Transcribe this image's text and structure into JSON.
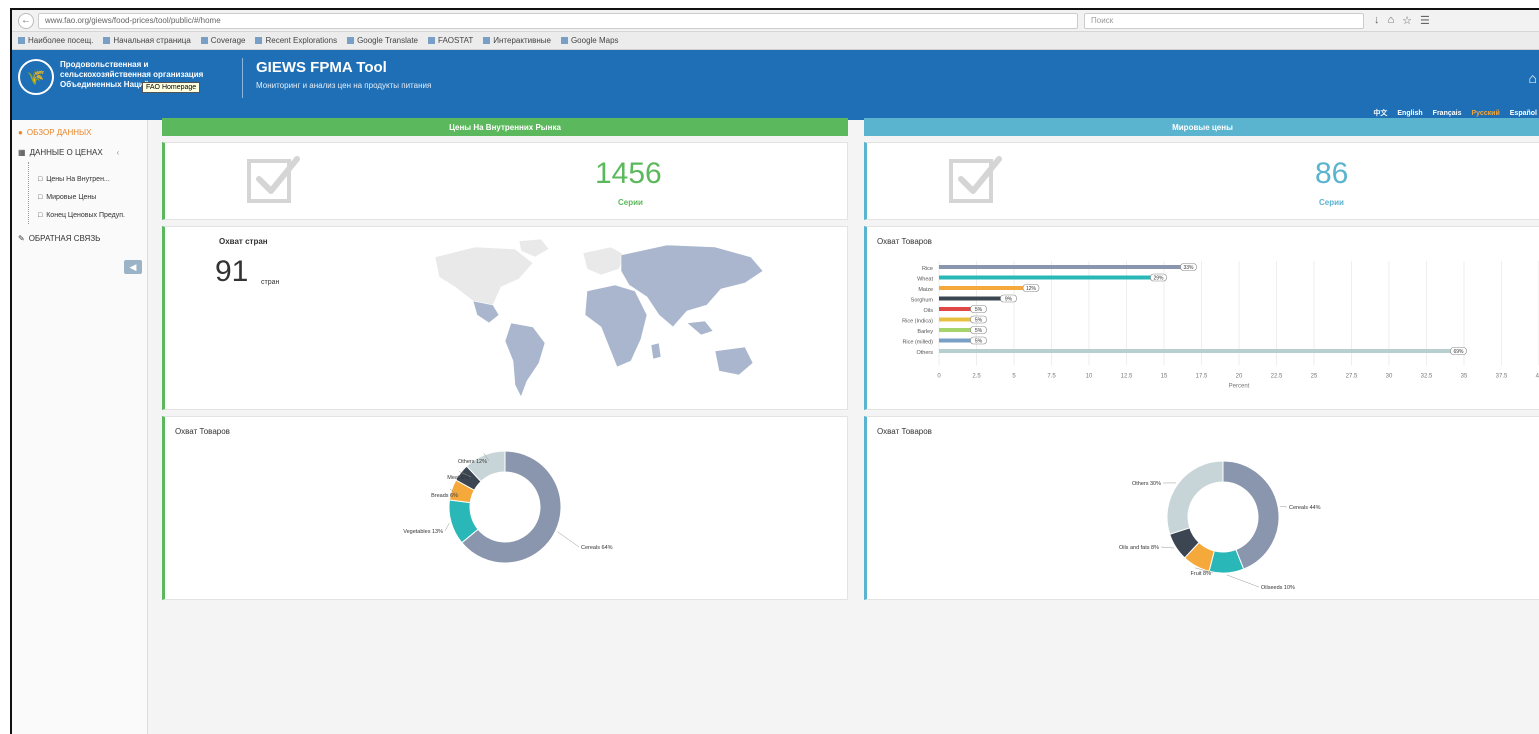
{
  "header": {
    "org_name": "Продовольственная и сельскохозяйственная организация Объединенных Наций",
    "tooltip": "FAO Homepage",
    "title": "GIEWS FPMA Tool",
    "subtitle": "Мониторинг и анализ цен на продукты питания"
  },
  "languages": [
    {
      "label": "中文",
      "active": false
    },
    {
      "label": "English",
      "active": false
    },
    {
      "label": "Français",
      "active": false
    },
    {
      "label": "Русский",
      "active": true
    },
    {
      "label": "Español",
      "active": false
    }
  ],
  "sidebar": {
    "overview": "ОБЗОР ДАННЫХ",
    "price_data": "ДАННЫЕ О ЦЕНАХ",
    "sub_items": [
      "Цены На Внутрен...",
      "Мировые Цены",
      "Конец Ценовых Предуп."
    ],
    "feedback": "ОБРАТНАЯ СВЯЗЬ"
  },
  "domestic": {
    "header": "Цены На Внутренних Рынка",
    "count": "1456",
    "count_label": "Серии",
    "map_title": "Охват стран",
    "countries_num": "91",
    "countries_unit": "стран",
    "donut_title": "Охват Товаров"
  },
  "international": {
    "header": "Мировые цены",
    "count": "86",
    "count_label": "Серии",
    "bar_title": "Охват Товаров",
    "donut_title": "Охват Товаров"
  },
  "colors": {
    "green": "#5cb85c",
    "blue": "#5ab3cf",
    "header_blue": "#1f6fb6",
    "orange": "#e8872a"
  },
  "chart_data": [
    {
      "type": "bar",
      "title": "Охват Товаров",
      "categories": [
        "Rice",
        "Wheat",
        "Maize",
        "Sorghum",
        "Oils",
        "Rice (Indica)",
        "Barley",
        "Rice (milled)",
        "Others"
      ],
      "values": [
        33,
        29,
        12,
        9,
        5,
        5,
        5,
        5,
        69
      ],
      "data_labels": [
        "33%",
        "29%",
        "12%",
        "9%",
        "5%",
        "5%",
        "5%",
        "5%",
        "69%"
      ],
      "xlim": [
        0,
        80
      ],
      "ticks": [
        "0",
        "2.5",
        "5",
        "7.5",
        "10",
        "12.5",
        "15",
        "17.5",
        "20",
        "22.5",
        "25",
        "27.5",
        "30",
        "32.5",
        "35",
        "37.5",
        "40"
      ],
      "xlabel": "Percent",
      "colors": [
        "#8a96ad",
        "#2ab7b7",
        "#f6a93b",
        "#3b4652",
        "#e04848",
        "#e8c040",
        "#a5d46a",
        "#7a9fc6",
        "#b8cfcf"
      ]
    },
    {
      "type": "pie",
      "title": "Охват Товаров",
      "labels": [
        "Cereals",
        "Vegetables",
        "Breads",
        "Meat",
        "Others"
      ],
      "values": [
        64,
        13,
        6,
        5,
        12
      ],
      "label_text": [
        "Cereals 64%",
        "Vegetables 13%",
        "Breads 6%",
        "Meat 5%",
        "Others 12%"
      ],
      "colors": [
        "#8a96ad",
        "#2ab7b7",
        "#f6a93b",
        "#3b4652",
        "#c8d5d8"
      ]
    },
    {
      "type": "pie",
      "title": "Охват Товаров",
      "labels": [
        "Cereals",
        "Oilseeds",
        "Fruit",
        "Oils and fats",
        "Others"
      ],
      "values": [
        44,
        10,
        8,
        8,
        30
      ],
      "label_text": [
        "Cereals 44%",
        "Oilseeds 10%",
        "Fruit 8%",
        "Oils and fats 8%",
        "Others 30%"
      ],
      "colors": [
        "#8a96ad",
        "#2ab7b7",
        "#f6a93b",
        "#3b4652",
        "#c8d5d8"
      ]
    }
  ]
}
